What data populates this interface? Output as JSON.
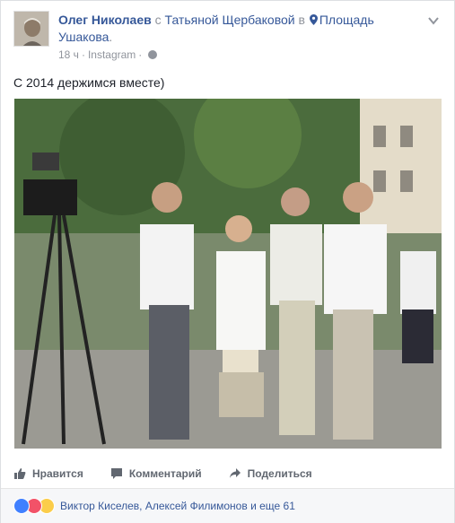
{
  "header": {
    "author": "Олег Николаев",
    "with_word": "с",
    "tagged": "Татьяной Щербаковой",
    "in_word": "в",
    "place": "Площадь Ушакова",
    "period": ".",
    "time": "18 ч",
    "dot": "·",
    "source": "Instagram",
    "dot2": "·"
  },
  "post": {
    "text": "С 2014 держимся вместе)"
  },
  "actions": {
    "like": "Нравится",
    "comment": "Комментарий",
    "share": "Поделиться"
  },
  "reactions": {
    "names": "Виктор Киселев, Алексей Филимонов и еще 61",
    "icons": [
      "like-icon",
      "love-icon",
      "wow-icon"
    ]
  },
  "colors": {
    "link": "#365899",
    "muted": "#90949c",
    "like": "#4080ff",
    "love": "#f25268",
    "wow": "#fbcd4a"
  }
}
